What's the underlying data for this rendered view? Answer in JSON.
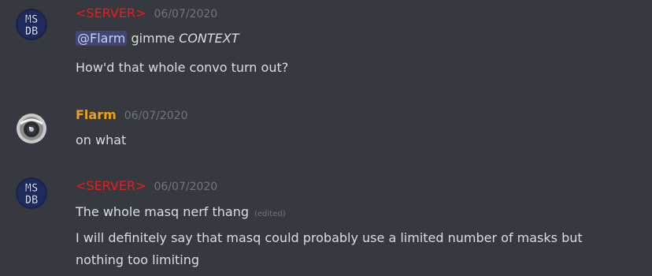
{
  "messages": [
    {
      "author": "<SERVER>",
      "author_color": "#f21919",
      "timestamp": "06/07/2020",
      "avatar_text_top": "MS",
      "avatar_text_bottom": "DB",
      "lines": [
        {
          "mention": "@Flarm",
          "text": "gimme",
          "emphasis": "CONTEXT"
        },
        {
          "text": "How'd that whole convo turn out?"
        }
      ]
    },
    {
      "author": "Flarm",
      "author_color": "#f09f19",
      "timestamp": "06/07/2020",
      "avatar_icon": "robot-eye-icon",
      "lines": [
        {
          "text": "on what"
        }
      ]
    },
    {
      "author": "<SERVER>",
      "author_color": "#f21919",
      "timestamp": "06/07/2020",
      "avatar_text_top": "MS",
      "avatar_text_bottom": "DB",
      "lines": [
        {
          "text": "The whole masq nerf thang",
          "edited": "(edited)"
        },
        {
          "text": "I will definitely say that masq could probably use a limited number of masks but"
        },
        {
          "text": "nothing too limiting"
        }
      ]
    }
  ],
  "colors": {
    "background": "#36393f",
    "text": "#dcddde",
    "muted": "#72767d",
    "mention_bg": "#414675",
    "mention_text": "#c9cdfb",
    "avatar_msdb_bg": "#1a2347"
  }
}
